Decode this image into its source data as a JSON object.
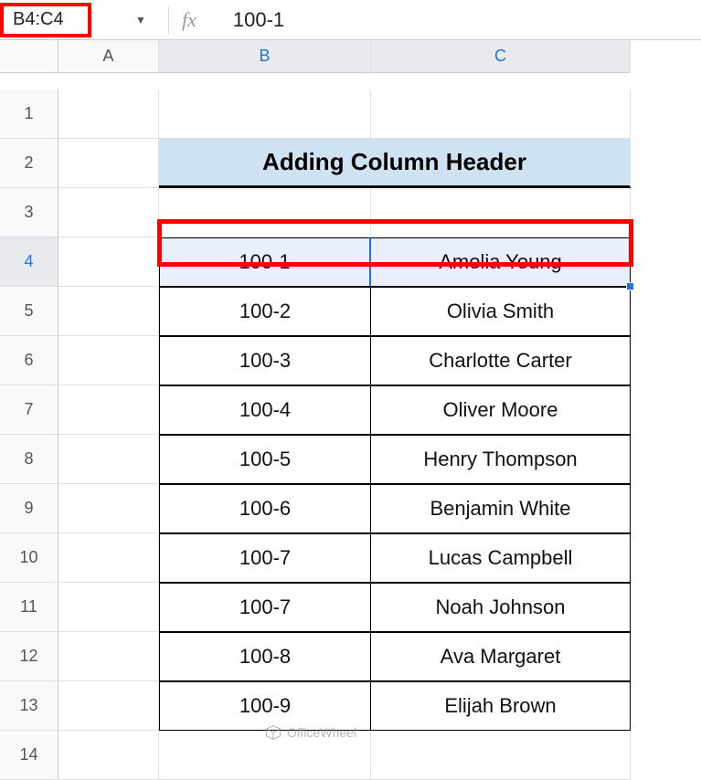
{
  "formula_bar": {
    "name_box": "B4:C4",
    "fx_label": "fx",
    "formula_value": "100-1"
  },
  "columns": [
    "A",
    "B",
    "C"
  ],
  "rows": [
    "1",
    "2",
    "3",
    "4",
    "5",
    "6",
    "7",
    "8",
    "9",
    "10",
    "11",
    "12",
    "13",
    "14"
  ],
  "title": "Adding Column Header",
  "table": [
    {
      "id": "100-1",
      "name": "Amelia Young"
    },
    {
      "id": "100-2",
      "name": "Olivia Smith"
    },
    {
      "id": "100-3",
      "name": "Charlotte Carter"
    },
    {
      "id": "100-4",
      "name": "Oliver Moore"
    },
    {
      "id": "100-5",
      "name": "Henry Thompson"
    },
    {
      "id": "100-6",
      "name": "Benjamin White"
    },
    {
      "id": "100-7",
      "name": "Lucas Campbell"
    },
    {
      "id": "100-7",
      "name": "Noah Johnson"
    },
    {
      "id": "100-8",
      "name": "Ava Margaret"
    },
    {
      "id": "100-9",
      "name": "Elijah Brown"
    }
  ],
  "watermark": "OfficeWheel",
  "selected_row": "4",
  "selected_cols": [
    "B",
    "C"
  ]
}
